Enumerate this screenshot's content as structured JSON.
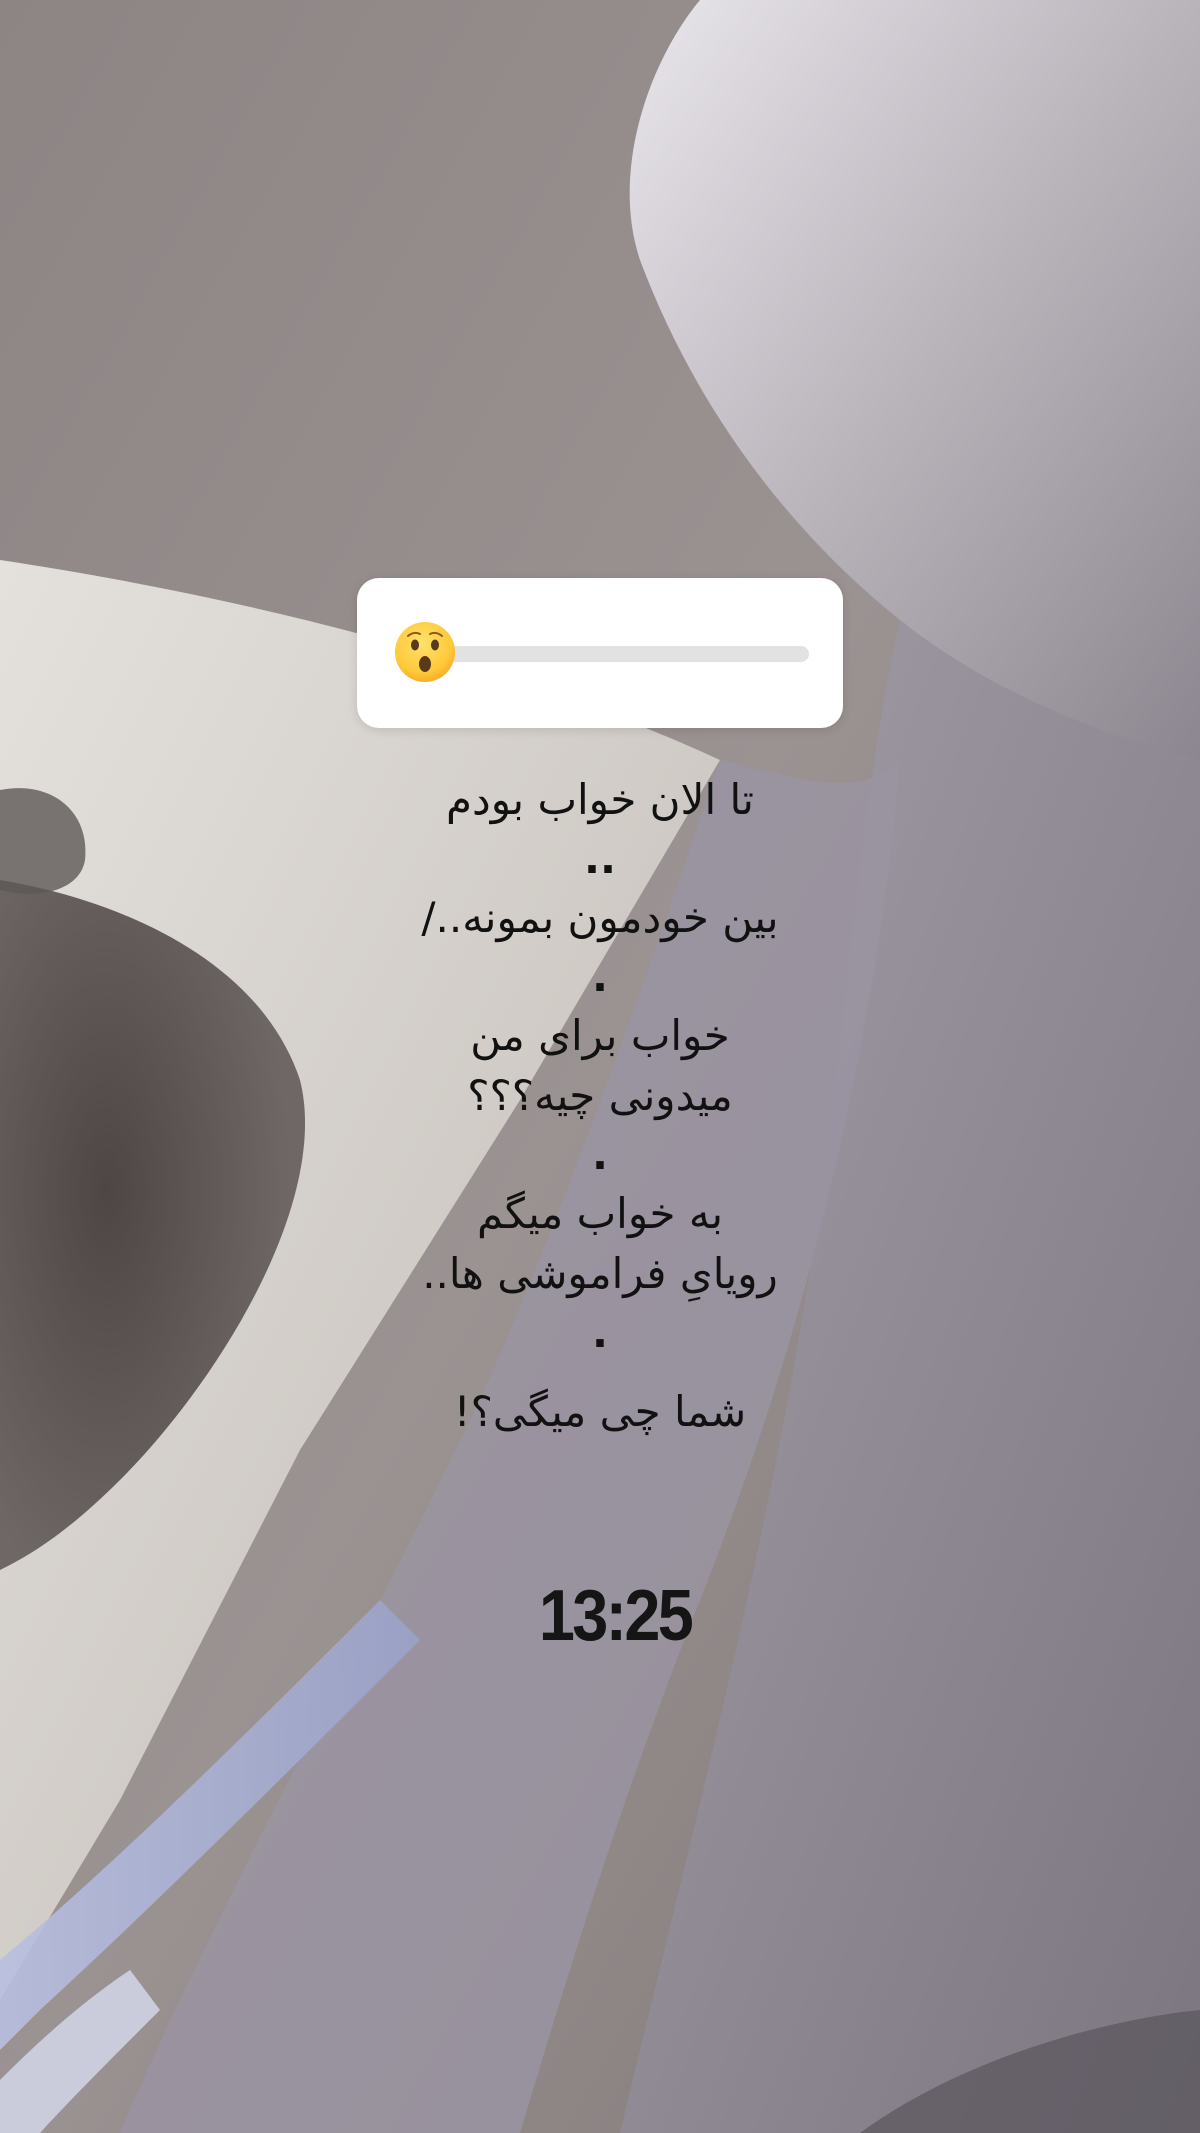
{
  "slider": {
    "emoji": "😮",
    "emoji_icon": "surprised-face-icon",
    "value": 0.0
  },
  "caption": {
    "line1": "تا الان خواب بودم",
    "dots1": "..",
    "line2": "بین خودمون بمونه../",
    "dot2": ".",
    "line3": "خواب برای من",
    "line4": "میدونی چیه؟؟؟",
    "dot3": ".",
    "line5": "به خواب میگم",
    "line6": "رویایِ فراموشی ها..",
    "dot4": ".",
    "line7": "شما چی میگی؟!"
  },
  "time_sticker": "13:25",
  "colors": {
    "card": "#ffffff",
    "track": "#e2e2e2",
    "text": "#111111"
  }
}
